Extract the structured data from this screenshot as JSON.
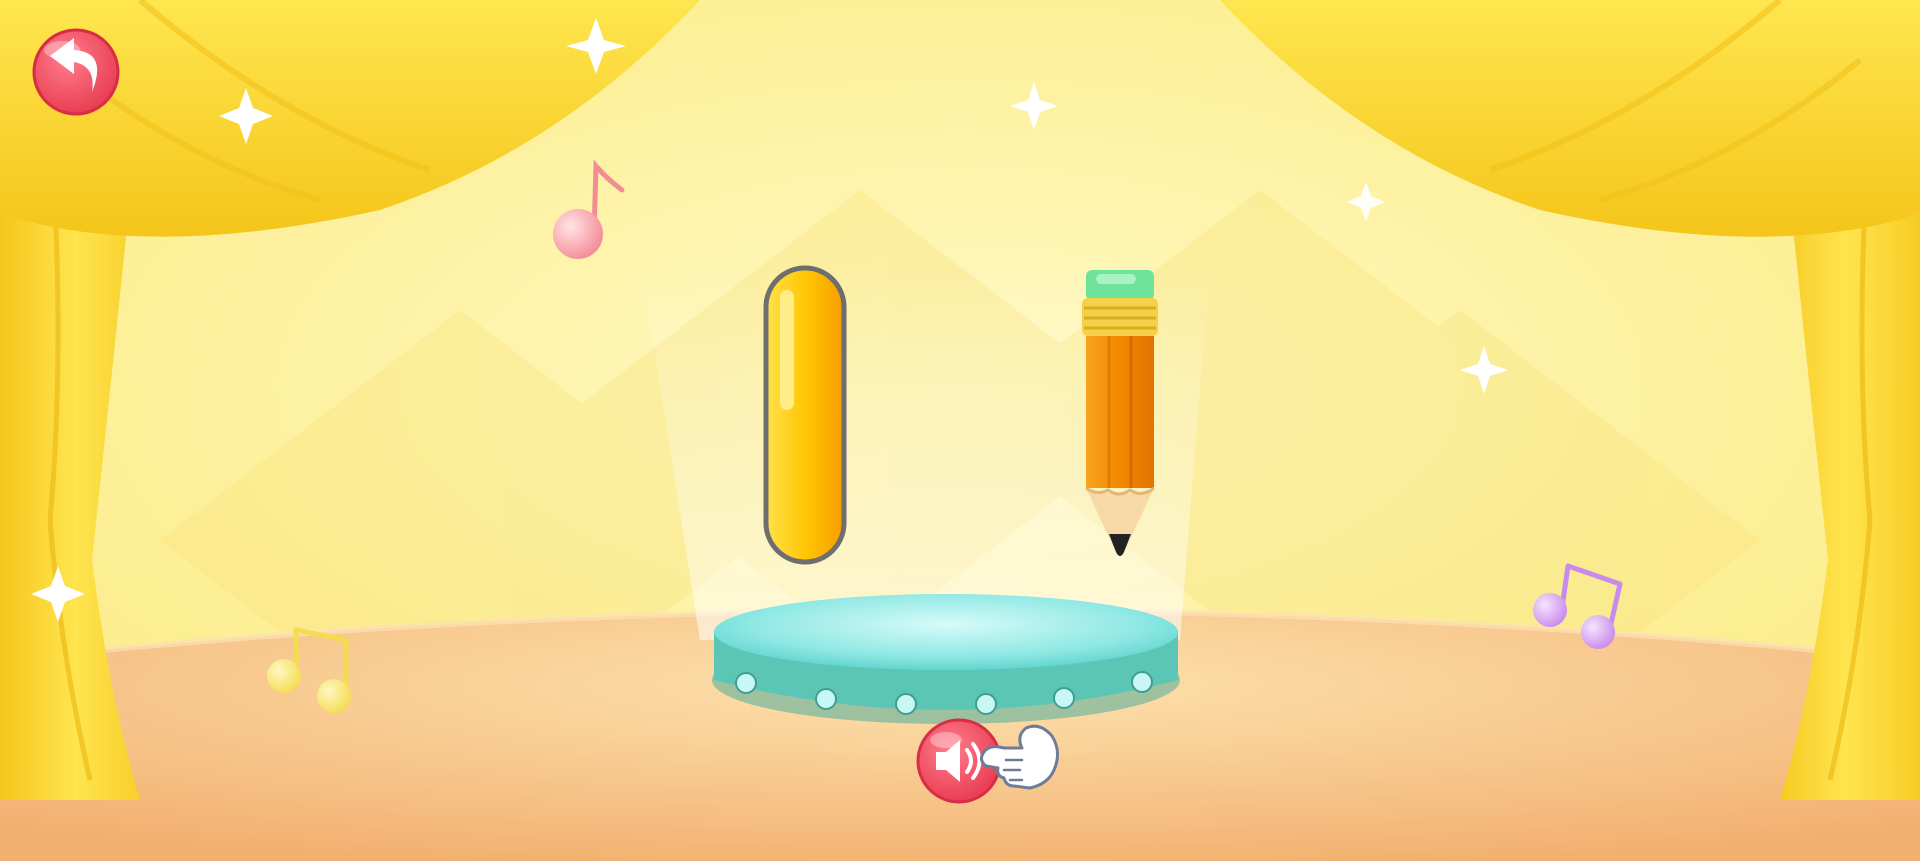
{
  "screen": {
    "name": "stroke-tracing-lesson"
  },
  "palette": {
    "backdrop": "#FBF1A6",
    "curtain_light": "#FFE34D",
    "curtain_dark": "#F3C71B",
    "floor": "#F5BE7C",
    "floor_light": "#FCDCA6",
    "stroke_fill": "#FFC800",
    "stroke_outline": "#6E6E6E",
    "pencil_body": "#F28A00",
    "pencil_eraser": "#6FE39A",
    "pencil_band": "#F5D04A",
    "platform_top": "#8FE8E4",
    "platform_side": "#5CC6B6",
    "button_red": "#EF4F63",
    "note_pink": "#F7A1A8",
    "note_yellow": "#F7E36A",
    "note_purple": "#D59BF0"
  },
  "controls": {
    "back_icon": "back-arrow-icon",
    "sound_icon": "speaker-icon",
    "hint_icon": "pointing-hand-icon"
  },
  "stroke": {
    "shape": "vertical-line",
    "state": "filled"
  },
  "tool": {
    "name": "pencil",
    "eraser_color": "green"
  }
}
